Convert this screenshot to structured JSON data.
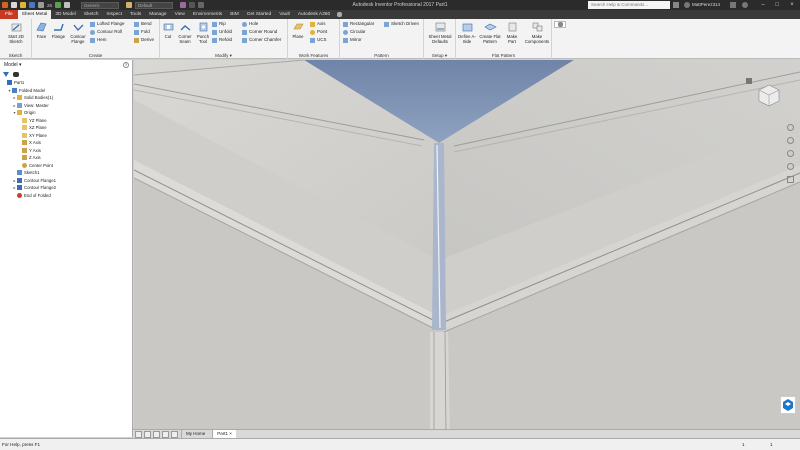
{
  "titlebar": {
    "app_title": "Autodesk Inventor Professional 2017    Part1",
    "material": "Generic",
    "appearance": "Default",
    "search_placeholder": "Search Help & Commands...",
    "user": "MattPerez314",
    "counter": "26"
  },
  "tabs": [
    "File",
    "Sheet Metal",
    "3D Model",
    "Sketch",
    "Inspect",
    "Tools",
    "Manage",
    "View",
    "Environments",
    "BIM",
    "Get Started",
    "Vault",
    "Autodesk A360"
  ],
  "ribbon": {
    "sketch": {
      "label": "Sketch",
      "start_sketch": "Start 2D Sketch"
    },
    "create": {
      "label": "Create",
      "face": "Face",
      "flange": "Flange",
      "contour_flange": "Contour Flange",
      "lofted_flange": "Lofted Flange",
      "contour_roll": "Contour Roll",
      "hem": "Hem",
      "bend": "Bend",
      "fold": "Fold",
      "derive": "Derive"
    },
    "modify": {
      "label": "Modify",
      "cut": "Cut",
      "corner_seam": "Corner Seam",
      "punch_tool": "Punch Tool",
      "rip": "Rip",
      "unfold": "Unfold",
      "refold": "Refold",
      "hole": "Hole",
      "corner_round": "Corner Round",
      "corner_chamfer": "Corner Chamfer"
    },
    "work_features": {
      "label": "Work Features",
      "plane": "Plane",
      "axis": "Axis",
      "point": "Point",
      "ucs": "UCS"
    },
    "pattern": {
      "label": "Pattern",
      "rectangular": "Rectangular",
      "circular": "Circular",
      "mirror": "Mirror",
      "sketch_driven": "Sketch Driven"
    },
    "setup": {
      "label": "Setup",
      "sheet_metal_defaults": "Sheet Metal Defaults"
    },
    "flat_pattern": {
      "label": "Flat Pattern",
      "define_a_side": "Define A-Side",
      "create_flat_pattern": "Create Flat Pattern",
      "make_part": "Make Part",
      "make_components": "Make Components"
    }
  },
  "browser": {
    "title": "Model",
    "tree": [
      {
        "label": "Part1",
        "indent": 0,
        "exp": "",
        "icon": "part"
      },
      {
        "label": "Folded Model",
        "indent": 1,
        "exp": "-",
        "icon": "folded"
      },
      {
        "label": "Solid Bodies(1)",
        "indent": 2,
        "exp": "+",
        "icon": "folder"
      },
      {
        "label": "View: Master",
        "indent": 2,
        "exp": "+",
        "icon": "view"
      },
      {
        "label": "Origin",
        "indent": 2,
        "exp": "-",
        "icon": "folder"
      },
      {
        "label": "YZ Plane",
        "indent": 3,
        "exp": "",
        "icon": "plane"
      },
      {
        "label": "XZ Plane",
        "indent": 3,
        "exp": "",
        "icon": "plane"
      },
      {
        "label": "XY Plane",
        "indent": 3,
        "exp": "",
        "icon": "plane"
      },
      {
        "label": "X Axis",
        "indent": 3,
        "exp": "",
        "icon": "axis"
      },
      {
        "label": "Y Axis",
        "indent": 3,
        "exp": "",
        "icon": "axis"
      },
      {
        "label": "Z Axis",
        "indent": 3,
        "exp": "",
        "icon": "axis"
      },
      {
        "label": "Center Point",
        "indent": 3,
        "exp": "",
        "icon": "point"
      },
      {
        "label": "Sketch1",
        "indent": 2,
        "exp": "",
        "icon": "sketch"
      },
      {
        "label": "Contour Flange1",
        "indent": 2,
        "exp": "+",
        "icon": "flange"
      },
      {
        "label": "Contour Flange2",
        "indent": 2,
        "exp": "+",
        "icon": "flange"
      },
      {
        "label": "End of Folded",
        "indent": 2,
        "exp": "",
        "icon": "end"
      }
    ]
  },
  "doc_tabs": {
    "home": "My Home",
    "part": "Part1"
  },
  "status": {
    "help": "For Help, press F1",
    "num1": "1",
    "num2": "1"
  },
  "colors": {
    "file_tab": "#c73a22",
    "sky": "#7f93b3",
    "metal": "#d4d3d0",
    "accent": "#1e78c8"
  }
}
